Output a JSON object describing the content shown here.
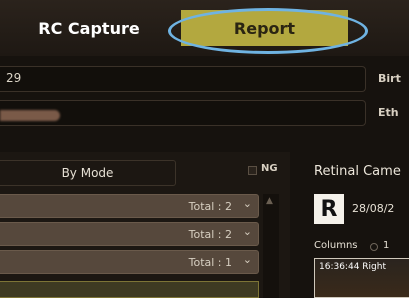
{
  "tabs": {
    "rc_capture": "RC Capture",
    "report": "Report"
  },
  "patient": {
    "id_fragment": "29",
    "birth_label": "Birt",
    "ethnicity_label": "Eth"
  },
  "list": {
    "mode_tab": "By Mode",
    "ng_label": "NG",
    "groups": [
      {
        "total": "Total : 2"
      },
      {
        "total": "Total : 2"
      },
      {
        "total": "Total : 1"
      }
    ]
  },
  "viewer": {
    "title": "Retinal Came",
    "badge": "R",
    "date": "28/08/2",
    "columns_label": "Columns",
    "columns_value": "1",
    "thumb_caption": "16:36:44 Right"
  },
  "colors": {
    "accent": "#b3a83f",
    "highlight_ring": "#6fb3e2"
  }
}
